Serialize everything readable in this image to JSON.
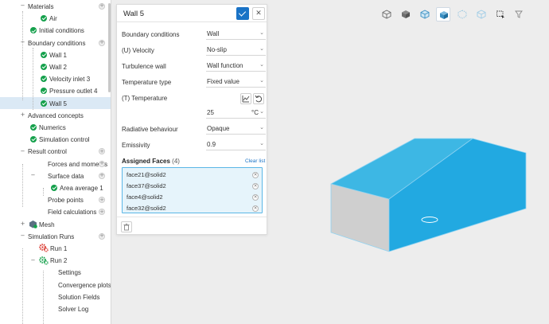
{
  "tree": {
    "items": [
      {
        "label": "Materials",
        "kind": "group"
      },
      {
        "label": "Air",
        "kind": "check"
      },
      {
        "label": "Initial conditions",
        "kind": "check"
      },
      {
        "label": "Boundary conditions",
        "kind": "group"
      },
      {
        "label": "Wall 1",
        "kind": "check"
      },
      {
        "label": "Wall 2",
        "kind": "check"
      },
      {
        "label": "Velocity inlet 3",
        "kind": "check"
      },
      {
        "label": "Pressure outlet 4",
        "kind": "check"
      },
      {
        "label": "Wall 5",
        "kind": "check"
      },
      {
        "label": "Advanced concepts",
        "kind": "group"
      },
      {
        "label": "Numerics",
        "kind": "check"
      },
      {
        "label": "Simulation control",
        "kind": "check"
      },
      {
        "label": "Result control",
        "kind": "group"
      },
      {
        "label": "Forces and moments",
        "kind": "plain"
      },
      {
        "label": "Surface data",
        "kind": "plain"
      },
      {
        "label": "Area average 1",
        "kind": "check"
      },
      {
        "label": "Probe points",
        "kind": "plain"
      },
      {
        "label": "Field calculations",
        "kind": "plain"
      },
      {
        "label": "Mesh",
        "kind": "mesh"
      },
      {
        "label": "Simulation Runs",
        "kind": "group"
      },
      {
        "label": "Run 1",
        "kind": "gear-red"
      },
      {
        "label": "Run 2",
        "kind": "gear-green"
      },
      {
        "label": "Settings",
        "kind": "plain"
      },
      {
        "label": "Convergence plots",
        "kind": "plain"
      },
      {
        "label": "Solution Fields",
        "kind": "plain"
      },
      {
        "label": "Solver Log",
        "kind": "plain"
      }
    ]
  },
  "panel": {
    "title": "Wall 5",
    "fields": [
      {
        "label": "Boundary conditions",
        "value": "Wall"
      },
      {
        "label": "(U) Velocity",
        "value": "No-slip"
      },
      {
        "label": "Turbulence wall",
        "value": "Wall function"
      },
      {
        "label": "Temperature type",
        "value": "Fixed value"
      },
      {
        "label": "(T) Temperature",
        "value": ""
      },
      {
        "label": "",
        "value": "25",
        "unit": "°C"
      },
      {
        "label": "Radiative behaviour",
        "value": "Opaque"
      },
      {
        "label": "Emissivity",
        "value": "0.9"
      }
    ],
    "assigned_faces_label": "Assigned Faces",
    "assigned_faces_count": "(4)",
    "clear_list": "Clear list",
    "faces": [
      "face21@solid2",
      "face37@solid2",
      "face4@solid2",
      "face32@solid2"
    ]
  },
  "toolbar": {
    "icons": [
      "cube-outline-icon",
      "cube-solid-icon",
      "cube-edges-icon",
      "cube-shaded-edges-icon",
      "cube-points-icon",
      "box-select-icon",
      "filter-icon"
    ],
    "active_index": 3
  },
  "colors": {
    "accent": "#1a73c6",
    "selected_face": "#1fa8e0",
    "check": "#14a04b"
  }
}
